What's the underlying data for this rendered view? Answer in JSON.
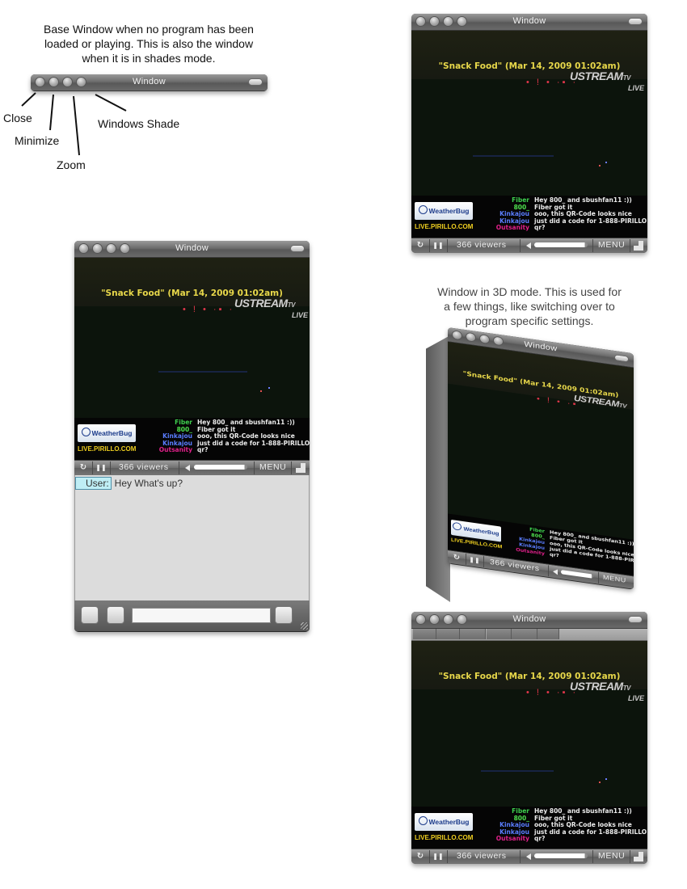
{
  "annotations": {
    "base_note": [
      "Base Window when no program has been",
      "loaded or playing.  This is also the window",
      "when it is in shades mode."
    ],
    "callouts": {
      "close": "Close",
      "minimize": "Minimize",
      "zoom": "Zoom",
      "shade": "Windows Shade"
    },
    "mode3d_note": [
      "Window in 3D mode.  This is used for",
      "a few things, like switching over to",
      "program specific settings."
    ]
  },
  "window": {
    "title": "Window"
  },
  "video": {
    "show_title": "\"Snack Food\" (Mar 14, 2009 01:02am)",
    "logo": "USTREAM",
    "logo_suffix": "TV",
    "live": "LIVE",
    "weatherbug": "WeatherBug",
    "site": "LIVE.PIRILLO.COM",
    "chat_lines": [
      {
        "nick": "Fiber",
        "msg": "Hey 800_ and sbushfan11 :))",
        "color": "#3ecf4e"
      },
      {
        "nick": "800_",
        "msg": "Fiber got it",
        "color": "#4ee04e"
      },
      {
        "nick": "Kinkajou",
        "msg": "ooo, this QR-Code looks nice",
        "color": "#5a7dff"
      },
      {
        "nick": "Kinkajou",
        "msg": "just did a code for 1-888-PIRILLO",
        "color": "#5a7dff"
      },
      {
        "nick": "Outsanity",
        "msg": "qr?",
        "color": "#e0208a"
      }
    ]
  },
  "controls": {
    "reload_glyph": "↻",
    "pause_glyph": "❚❚",
    "viewers": "366 viewers",
    "menu": "MENU",
    "volume_level": 0.95
  },
  "chat_window": {
    "user_label": "User:",
    "message": "Hey What's up?",
    "input_value": ""
  },
  "colors": {
    "show_title": "#e8d84a",
    "site": "#f0d020",
    "user_label_bg": "#bfeef5"
  }
}
